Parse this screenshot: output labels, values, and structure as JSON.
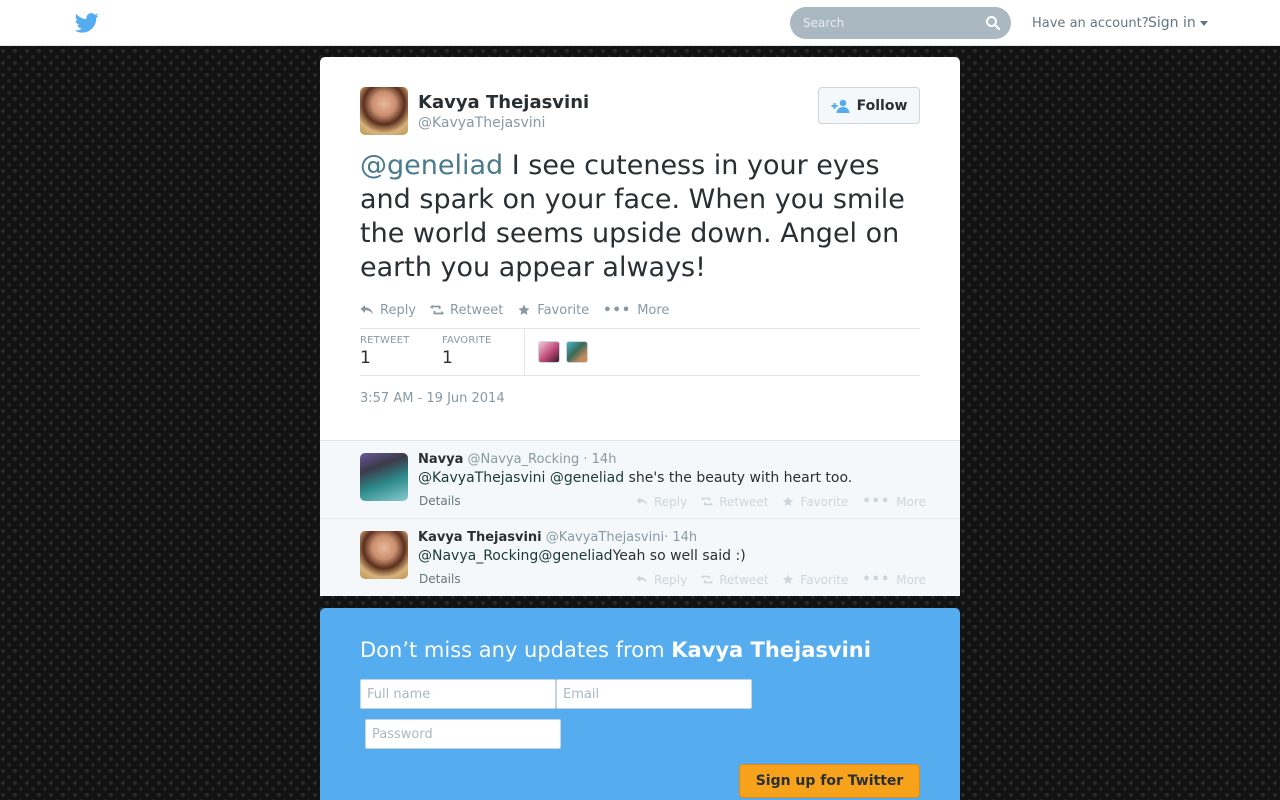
{
  "header": {
    "search_placeholder": "Search",
    "have_account": "Have an account?",
    "sign_in": "Sign in"
  },
  "tweet": {
    "author_name": "Kavya Thejasvini",
    "author_handle": "@KavyaThejasvini",
    "follow_label": "Follow",
    "mention": "@geneliad",
    "body": " I see cuteness in your eyes and spark on your face. When you smile the world seems upside down. Angel on earth you appear always!",
    "actions": {
      "reply": "Reply",
      "retweet": "Retweet",
      "favorite": "Favorite",
      "more": "More"
    },
    "stats": {
      "retweet_label": "RETWEET",
      "retweet_count": "1",
      "favorite_label": "FAVORITE",
      "favorite_count": "1"
    },
    "timestamp": "3:57 AM - 19 Jun 2014"
  },
  "replies": [
    {
      "name": "Navya",
      "handle": "@Navya_Rocking",
      "time": " · 14h",
      "mention1": "@KavyaThejasvini",
      "mention2": "@geneliad",
      "text": "she's the beauty with heart too.",
      "details": "Details",
      "actions": {
        "reply": "Reply",
        "retweet": "Retweet",
        "favorite": "Favorite",
        "more": "More"
      }
    },
    {
      "name": "Kavya Thejasvini",
      "handle": "@KavyaThejasvini",
      "time": "· 14h",
      "mention1": "@Navya_Rocking",
      "mention2": "@geneliad",
      "text": "Yeah so well said :)",
      "details": "Details",
      "actions": {
        "reply": "Reply",
        "retweet": "Retweet",
        "favorite": "Favorite",
        "more": "More"
      }
    }
  ],
  "signup": {
    "title_prefix": "Don’t miss any updates from ",
    "title_name": "Kavya Thejasvini",
    "fullname_placeholder": "Full name",
    "email_placeholder": "Email",
    "password_placeholder": "Password",
    "button_label": "Sign up for Twitter"
  },
  "colors": {
    "brand_blue": "#55acee",
    "signup_button": "#f7a21b",
    "muted_text": "#8899a6"
  }
}
